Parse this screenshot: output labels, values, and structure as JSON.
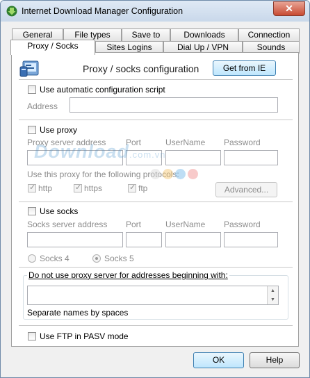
{
  "window": {
    "title": "Internet Download Manager Configuration",
    "close_symbol": "✕"
  },
  "tabs_row1": [
    "General",
    "File types",
    "Save to",
    "Downloads",
    "Connection"
  ],
  "tabs_row2": [
    "Proxy / Socks",
    "Sites Logins",
    "Dial Up / VPN",
    "Sounds"
  ],
  "header": {
    "title": "Proxy / socks configuration",
    "get_from_ie": "Get from IE"
  },
  "auto_script": {
    "label": "Use automatic configuration script",
    "address_label": "Address",
    "address_value": ""
  },
  "proxy": {
    "use_label": "Use proxy",
    "server_label": "Proxy server address",
    "port_label": "Port",
    "username_label": "UserName",
    "password_label": "Password",
    "protocols_label": "Use this proxy for the following protocols:",
    "http": "http",
    "https": "https",
    "ftp": "ftp",
    "advanced": "Advanced..."
  },
  "socks": {
    "use_label": "Use socks",
    "server_label": "Socks server address",
    "port_label": "Port",
    "username_label": "UserName",
    "password_label": "Password",
    "socks4": "Socks 4",
    "socks5": "Socks 5"
  },
  "bypass": {
    "label": "Do not use proxy server for addresses beginning with:",
    "hint": "Separate names by spaces",
    "value": ""
  },
  "ftp_pasv": {
    "label": "Use FTP in PASV mode"
  },
  "buttons": {
    "ok": "OK",
    "help": "Help"
  },
  "watermark": {
    "text": "Download",
    "suffix": ".com.vn"
  },
  "colors": {
    "accent": "#3c7fb1",
    "watermark": "#3c8cc8"
  }
}
